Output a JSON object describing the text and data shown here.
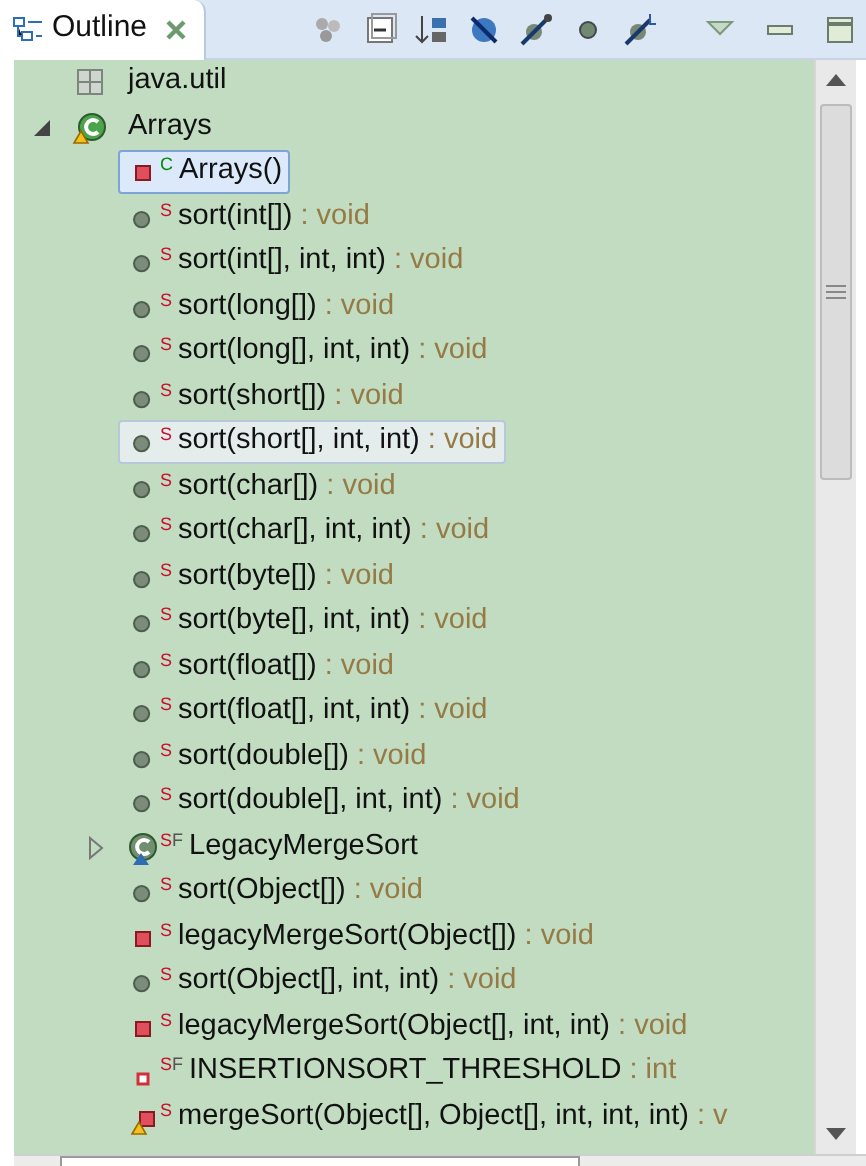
{
  "tab": {
    "title": "Outline"
  },
  "tree": [
    {
      "kind": "imports",
      "label": "java.util",
      "selected": false,
      "hovered": false
    },
    {
      "kind": "public_class",
      "warning": true,
      "label": "Arrays",
      "expanded": true,
      "selected": false,
      "hovered": false,
      "children": [
        {
          "kind": "private_constructor",
          "modifiers": [
            {
              "text": "C",
              "color": "#008a00"
            }
          ],
          "label": "Arrays()",
          "selected": true,
          "hovered": false
        },
        {
          "kind": "method",
          "modifiers": [
            {
              "text": "S",
              "color": "#c8102e"
            }
          ],
          "label": "sort(int[])",
          "type": ": void",
          "selected": false,
          "hovered": false
        },
        {
          "kind": "method",
          "modifiers": [
            {
              "text": "S",
              "color": "#c8102e"
            }
          ],
          "label": "sort(int[], int, int)",
          "type": ": void",
          "selected": false,
          "hovered": false
        },
        {
          "kind": "method",
          "modifiers": [
            {
              "text": "S",
              "color": "#c8102e"
            }
          ],
          "label": "sort(long[])",
          "type": ": void",
          "selected": false,
          "hovered": false
        },
        {
          "kind": "method",
          "modifiers": [
            {
              "text": "S",
              "color": "#c8102e"
            }
          ],
          "label": "sort(long[], int, int)",
          "type": ": void",
          "selected": false,
          "hovered": false
        },
        {
          "kind": "method",
          "modifiers": [
            {
              "text": "S",
              "color": "#c8102e"
            }
          ],
          "label": "sort(short[])",
          "type": ": void",
          "selected": false,
          "hovered": false
        },
        {
          "kind": "method",
          "modifiers": [
            {
              "text": "S",
              "color": "#c8102e"
            }
          ],
          "label": "sort(short[], int, int)",
          "type": ": void",
          "selected": false,
          "hovered": true
        },
        {
          "kind": "method",
          "modifiers": [
            {
              "text": "S",
              "color": "#c8102e"
            }
          ],
          "label": "sort(char[])",
          "type": ": void",
          "selected": false,
          "hovered": false
        },
        {
          "kind": "method",
          "modifiers": [
            {
              "text": "S",
              "color": "#c8102e"
            }
          ],
          "label": "sort(char[], int, int)",
          "type": ": void",
          "selected": false,
          "hovered": false
        },
        {
          "kind": "method",
          "modifiers": [
            {
              "text": "S",
              "color": "#c8102e"
            }
          ],
          "label": "sort(byte[])",
          "type": ": void",
          "selected": false,
          "hovered": false
        },
        {
          "kind": "method",
          "modifiers": [
            {
              "text": "S",
              "color": "#c8102e"
            }
          ],
          "label": "sort(byte[], int, int)",
          "type": ": void",
          "selected": false,
          "hovered": false
        },
        {
          "kind": "method",
          "modifiers": [
            {
              "text": "S",
              "color": "#c8102e"
            }
          ],
          "label": "sort(float[])",
          "type": ": void",
          "selected": false,
          "hovered": false
        },
        {
          "kind": "method",
          "modifiers": [
            {
              "text": "S",
              "color": "#c8102e"
            }
          ],
          "label": "sort(float[], int, int)",
          "type": ": void",
          "selected": false,
          "hovered": false
        },
        {
          "kind": "method",
          "modifiers": [
            {
              "text": "S",
              "color": "#c8102e"
            }
          ],
          "label": "sort(double[])",
          "type": ": void",
          "selected": false,
          "hovered": false
        },
        {
          "kind": "method",
          "modifiers": [
            {
              "text": "S",
              "color": "#c8102e"
            }
          ],
          "label": "sort(double[], int, int)",
          "type": ": void",
          "selected": false,
          "hovered": false
        },
        {
          "kind": "default_class",
          "modifiers": [
            {
              "text": "S",
              "color": "#c8102e"
            },
            {
              "text": "F",
              "color": "#555555"
            }
          ],
          "label": "LegacyMergeSort",
          "expanded": false,
          "selected": false,
          "hovered": false
        },
        {
          "kind": "method",
          "modifiers": [
            {
              "text": "S",
              "color": "#c8102e"
            }
          ],
          "label": "sort(Object[])",
          "type": ": void",
          "selected": false,
          "hovered": false
        },
        {
          "kind": "private_method",
          "modifiers": [
            {
              "text": "S",
              "color": "#c8102e"
            }
          ],
          "label": "legacyMergeSort(Object[])",
          "type": ": void",
          "selected": false,
          "hovered": false
        },
        {
          "kind": "method",
          "modifiers": [
            {
              "text": "S",
              "color": "#c8102e"
            }
          ],
          "label": "sort(Object[], int, int)",
          "type": ": void",
          "selected": false,
          "hovered": false
        },
        {
          "kind": "private_method",
          "modifiers": [
            {
              "text": "S",
              "color": "#c8102e"
            }
          ],
          "label": "legacyMergeSort(Object[], int, int)",
          "type": ": void",
          "selected": false,
          "hovered": false
        },
        {
          "kind": "private_field",
          "modifiers": [
            {
              "text": "S",
              "color": "#c8102e"
            },
            {
              "text": "F",
              "color": "#555555"
            }
          ],
          "label": "INSERTIONSORT_THRESHOLD",
          "type": ": int",
          "selected": false,
          "hovered": false
        },
        {
          "kind": "private_method",
          "warning": true,
          "modifiers": [
            {
              "text": "S",
              "color": "#c8102e"
            }
          ],
          "label": "mergeSort(Object[], Object[], int, int, int)",
          "type": ": v",
          "selected": false,
          "hovered": false
        }
      ]
    }
  ]
}
